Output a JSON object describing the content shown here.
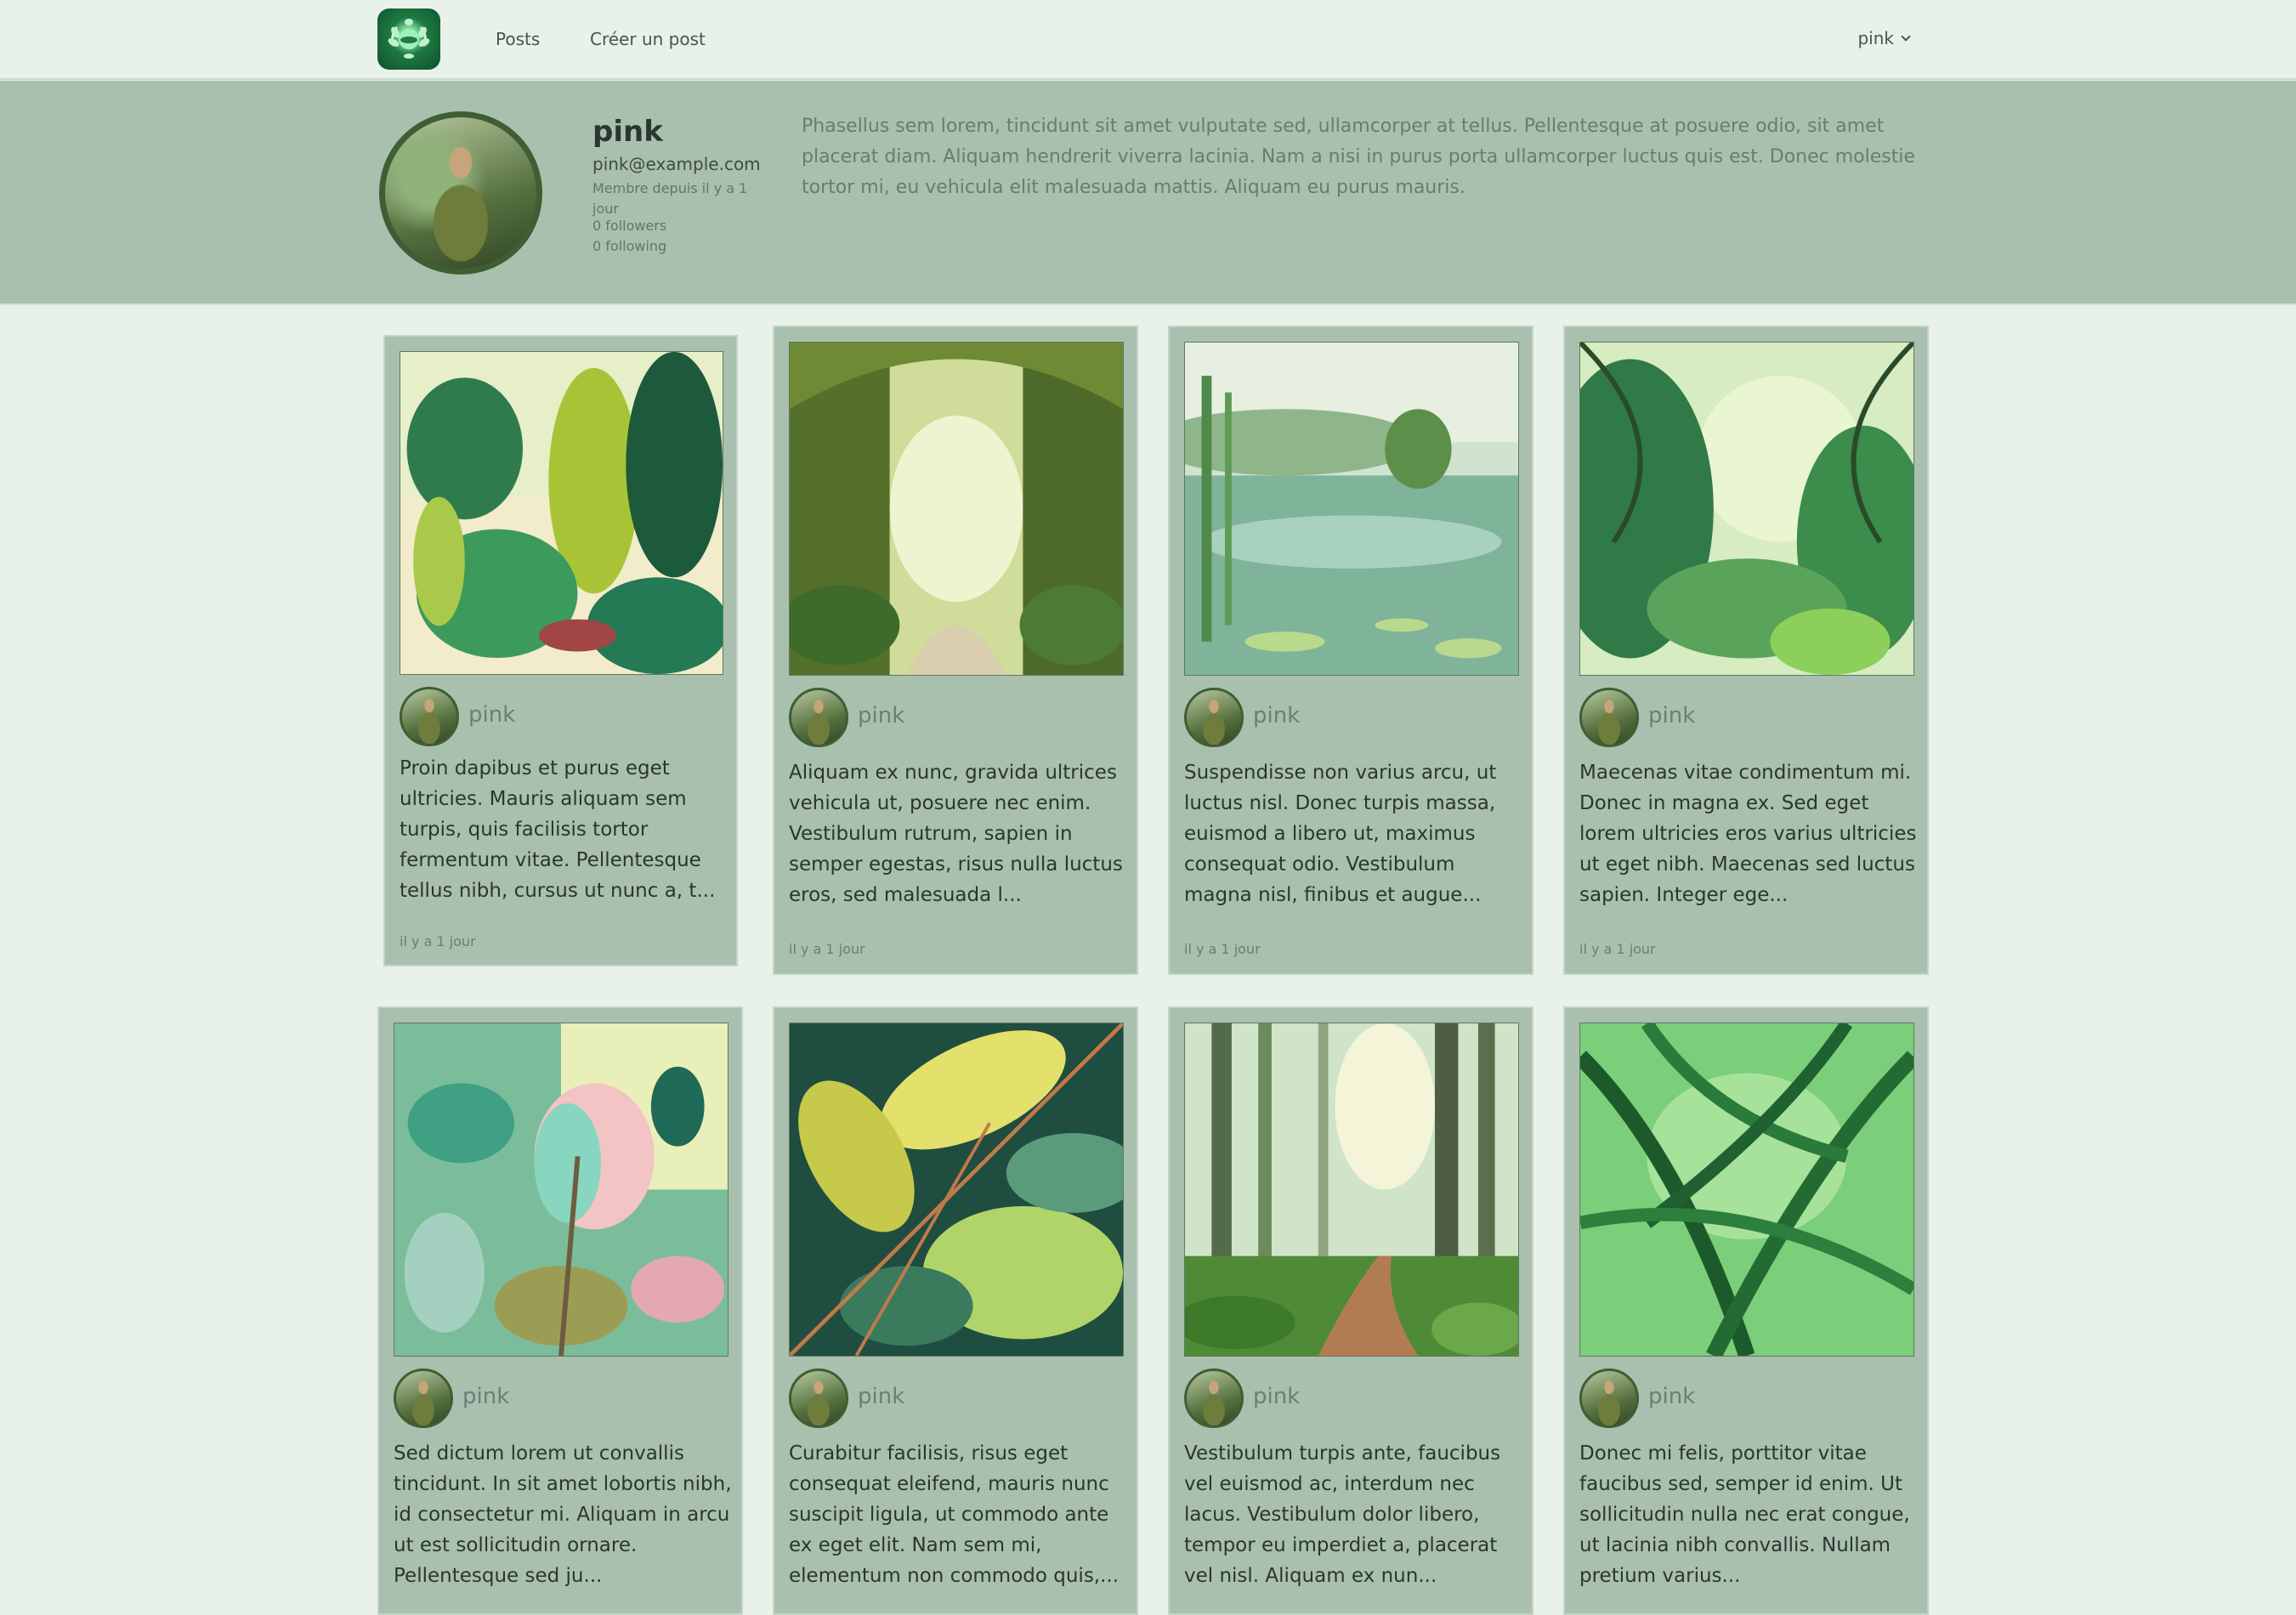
{
  "nav": {
    "links": [
      "Posts",
      "Créer un post"
    ],
    "user": "pink"
  },
  "profile": {
    "name": "pink",
    "email": "pink@example.com",
    "since": "Membre depuis il y a 1 jour",
    "followers": "0 followers",
    "following": "0 following",
    "bio": "Phasellus sem lorem, tincidunt sit amet vulputate sed, ullamcorper at tellus. Pellentesque at posuere odio, sit amet placerat diam. Aliquam hendrerit viverra lacinia. Nam a nisi in purus porta ullamcorper luctus quis est. Donec molestie tortor mi, eu vehicula elit malesuada mattis. Aliquam eu purus mauris."
  },
  "posts": [
    {
      "user": "pink",
      "text": "Proin dapibus et purus eget ultricies. Mauris aliquam sem turpis, quis facilisis tortor fermentum vitae. Pellentesque tellus nibh, cursus ut nunc a, t...",
      "time": "il y a 1 jour"
    },
    {
      "user": "pink",
      "text": "Aliquam ex nunc, gravida ultrices vehicula ut, posuere nec enim. Vestibulum rutrum, sapien in semper egestas, risus nulla luctus eros, sed malesuada l...",
      "time": "il y a 1 jour"
    },
    {
      "user": "pink",
      "text": "Suspendisse non varius arcu, ut luctus nisl. Donec turpis massa, euismod a libero ut, maximus consequat odio. Vestibulum magna nisl, finibus et augue...",
      "time": "il y a 1 jour"
    },
    {
      "user": "pink",
      "text": "Maecenas vitae condimentum mi. Donec in magna ex. Sed eget lorem ultricies eros varius ultricies ut eget nibh. Maecenas sed luctus sapien. Integer ege...",
      "time": "il y a 1 jour"
    },
    {
      "user": "pink",
      "text": "Sed dictum lorem ut convallis tincidunt. In sit amet lobortis nibh, id consectetur mi. Aliquam in arcu ut est sollicitudin ornare. Pellentesque sed ju...",
      "time": ""
    },
    {
      "user": "pink",
      "text": "Curabitur facilisis, risus eget consequat eleifend, mauris nunc suscipit ligula, ut commodo ante ex eget elit. Nam sem mi, elementum non commodo quis,...",
      "time": ""
    },
    {
      "user": "pink",
      "text": "Vestibulum turpis ante, faucibus vel euismod ac, interdum nec lacus. Vestibulum dolor libero, tempor eu imperdiet a, placerat vel nisl. Aliquam ex nun...",
      "time": ""
    },
    {
      "user": "pink",
      "text": "Donec mi felis, porttitor vitae faucibus sed, semper id enim. Ut sollicitudin nulla nec erat congue, ut lacinia nibh convallis. Nullam pretium varius...",
      "time": ""
    }
  ]
}
